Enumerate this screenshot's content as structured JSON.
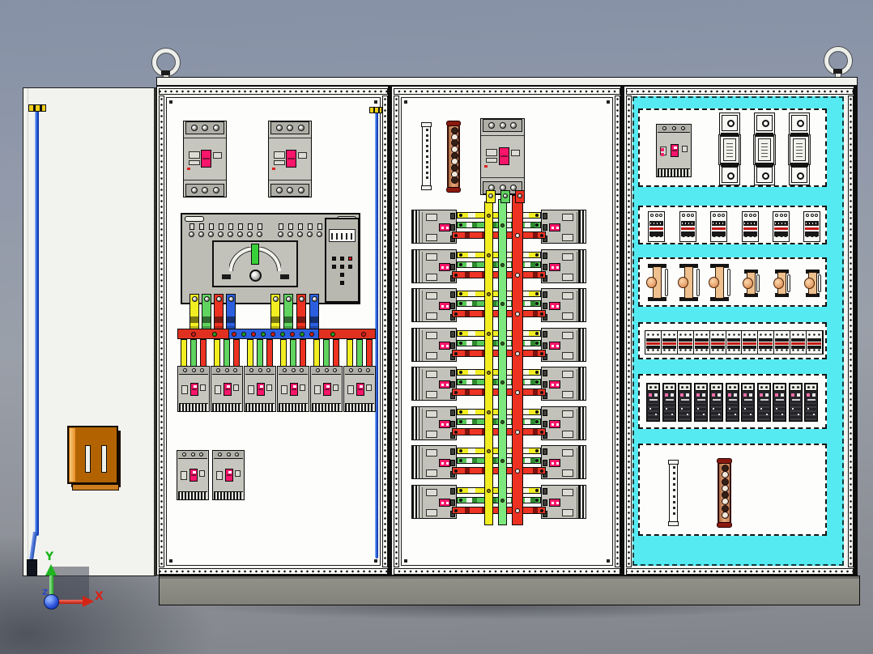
{
  "scene": {
    "axis_triad": {
      "x_label": "X",
      "y_label": "Y",
      "z_label": "Z",
      "x_color": "#d62418",
      "y_color": "#17b517",
      "z_color": "#2848c8"
    },
    "lifting_eye_count": 2
  },
  "palette": {
    "cabinet_white": "#f3f3f0",
    "plate_white": "#fdfdfb",
    "device_gray": "#c6c6be",
    "terminal_gray": "#aeaea6",
    "accent_pink": "#f8156a",
    "phase_yellow": "#f2ee22",
    "phase_green": "#5fd45f",
    "phase_green_light": "#7de87d",
    "phase_red": "#ee3222",
    "neutral_blue": "#2b5fe0",
    "copper": "#d79060",
    "cyan_plate": "#55eaf2",
    "insulator_tan": "#eec08e",
    "plinth_gray": "#8b8b82",
    "door_white": "#f2f2ef",
    "pocket_brown": "#b26300",
    "rod_blue": "#2a62dc",
    "clamp_yellow": "#f0d018",
    "ats_handle_green": "#38d038"
  },
  "sections": {
    "incoming": {
      "main_breaker_count": 2,
      "ats_led_colors": [
        "#181818",
        "#181818",
        "#cc1414",
        "#181818",
        "#181818",
        "#181818",
        "#181818",
        "#181818"
      ],
      "cable_colors": [
        "#f2ee22",
        "#5fd45f",
        "#ee3222",
        "#2b5fe0"
      ],
      "busbar_segment_colors": [
        "#e03020",
        "#2b5fe0",
        "#e03020"
      ],
      "busbar_dot_colors": [
        "#cc2018",
        "#1f9e1f"
      ],
      "branch_breaker_count": 6,
      "phase_colors": [
        "#f2ee22",
        "#5fd45f",
        "#ee3222"
      ],
      "spare_breaker_count": 2
    },
    "feeders": {
      "terminal_strip_dots": 10,
      "copper_bar_holes": 9,
      "busbar_colors": [
        "#f2ee22",
        "#7de87d",
        "#ee3222"
      ],
      "lug_colors": [
        "#f2ee22",
        "#5fd45f",
        "#ee3222"
      ],
      "row_count": 8,
      "breakers_per_row": 2
    },
    "auxiliary": {
      "main_breaker_count": 1,
      "fuse_count": 3,
      "relay_module_count": 6,
      "support_count": 6,
      "terminal_block_count": 11,
      "compact_breaker_count": 11,
      "terminal_strip_dots": 9,
      "copper_bar_holes": 8
    }
  }
}
